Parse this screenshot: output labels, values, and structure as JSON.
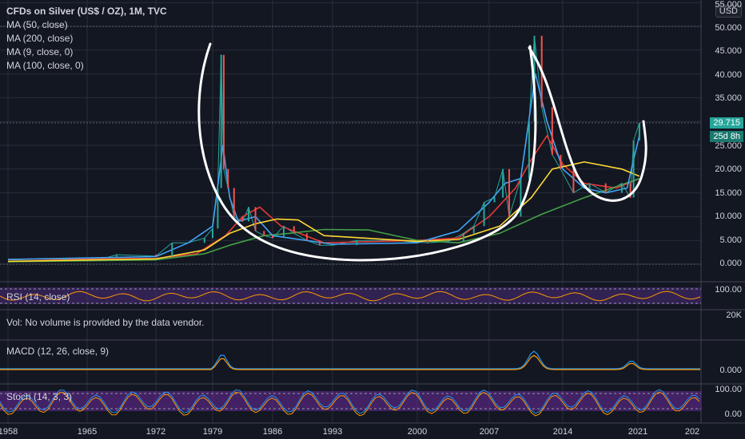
{
  "title": "CFDs on Silver (US$ / OZ), 1M, TVC",
  "indicators": [
    "MA (50, close)",
    "MA (200, close)",
    "MA (9, close, 0)",
    "MA (100, close, 0)"
  ],
  "currency": "USD",
  "last_price": "29.715",
  "countdown": "25d 8h",
  "rsi_label": "RSI (14, close)",
  "vol_label": "Vol: No volume is provided by the data vendor.",
  "macd_label": "MACD (12, 26, close, 9)",
  "stoch_label": "Stoch (14, 3, 3)",
  "colors": {
    "bg": "#131722",
    "grid": "#2a2e39",
    "candle_up": "#26a69a",
    "candle_down": "#ef5350",
    "ma50": "#e53935",
    "ma200": "#43a047",
    "ma9": "#42a5f5",
    "ma100": "#fdd835",
    "rsi_band": "#4a2c7a",
    "stoch_band": "#6a2c9a",
    "price_tag": "#26a69a",
    "annotation": "#ffffff"
  },
  "price_axis": [
    "55.000",
    "50.000",
    "45.000",
    "40.000",
    "35.000",
    "30.000",
    "25.000",
    "20.000",
    "15.000",
    "10.000",
    "5.000",
    "0.000"
  ],
  "rsi_axis": [
    "100.00"
  ],
  "vol_axis": [
    "20K"
  ],
  "macd_axis": [
    "0.000"
  ],
  "stoch_axis": [
    "100.00",
    "0.00"
  ],
  "time_axis": [
    "1958",
    "1965",
    "1972",
    "1979",
    "1986",
    "1993",
    "2000",
    "2007",
    "2014",
    "2021",
    "202"
  ],
  "chart_data": {
    "type": "line",
    "title": "CFDs on Silver (US$ / OZ), 1M, TVC",
    "xlabel": "",
    "ylabel": "",
    "xlim": [
      1958,
      2028
    ],
    "ylim": [
      0,
      55
    ],
    "y_ticks": [
      0,
      5,
      10,
      15,
      20,
      25,
      30,
      35,
      40,
      45,
      50,
      55
    ],
    "x_ticks": [
      1958,
      1965,
      1972,
      1979,
      1986,
      1993,
      2000,
      2007,
      2014,
      2021
    ],
    "series": [
      {
        "name": "",
        "role": "price",
        "x": [
          1958,
          1963,
          1967,
          1968,
          1972,
          1974,
          1976,
          1978,
          1979,
          1979.6,
          1980.0,
          1980.3,
          1980.8,
          1981.5,
          1982.5,
          1983.2,
          1984,
          1985,
          1986,
          1987.3,
          1988.5,
          1990,
          1991.5,
          1993,
          1995,
          1998,
          2001,
          2003,
          2004.5,
          2005.5,
          2006.5,
          2007.5,
          2008.3,
          2008.9,
          2010,
          2010.8,
          2011.3,
          2012,
          2013,
          2013.8,
          2015,
          2016.5,
          2018,
          2019.5,
          2020.3,
          2020.6,
          2021.2
        ],
        "y": [
          0.9,
          1.2,
          1.4,
          2.0,
          1.7,
          4.5,
          4.5,
          5.5,
          7.5,
          16,
          44,
          20,
          16,
          10,
          9,
          12,
          7,
          6,
          5.5,
          8,
          6.5,
          5,
          4,
          4,
          5,
          5,
          4.5,
          4.8,
          6.5,
          8,
          13,
          14,
          20,
          10,
          18,
          30,
          48,
          33,
          23,
          20,
          15,
          17,
          15,
          17,
          14,
          26,
          29.7
        ]
      },
      {
        "name": "MA (50, close)",
        "x": [
          1958,
          1972,
          1977,
          1980.5,
          1982.5,
          1984.5,
          1987,
          1992,
          2000,
          2004,
          2007,
          2009.5,
          2011,
          2012.5,
          2014,
          2016,
          2019,
          2021.2
        ],
        "y": [
          1,
          1.2,
          2.2,
          6,
          10,
          12,
          8,
          4.5,
          5,
          5.5,
          10,
          16,
          22,
          27,
          21,
          17,
          16,
          18
        ]
      },
      {
        "name": "MA (200, close)",
        "x": [
          1958,
          1972,
          1978,
          1981,
          1985,
          1988,
          1992,
          1996,
          2000,
          2004,
          2008,
          2012,
          2016,
          2021.2
        ],
        "y": [
          0.5,
          0.9,
          2.2,
          4,
          6,
          6.5,
          7.3,
          7.2,
          5,
          4.5,
          6.5,
          10.5,
          14,
          18
        ]
      },
      {
        "name": "MA (9, close, 0)",
        "x": [
          1958,
          1972,
          1976,
          1979,
          1980.2,
          1981,
          1982,
          1984,
          1986,
          1993,
          2000,
          2004,
          2007,
          2008.5,
          2010,
          2011.4,
          2012.5,
          2014,
          2016,
          2018,
          2020,
          2020.6,
          2021.2
        ],
        "y": [
          1,
          1.6,
          4.5,
          8,
          25,
          14,
          9,
          10,
          6,
          4.2,
          4.5,
          7,
          13,
          17,
          18,
          40,
          30,
          20,
          16,
          15,
          16,
          22,
          27
        ]
      },
      {
        "name": "MA (100, close, 0)",
        "x": [
          1958,
          1972,
          1978,
          1981,
          1984,
          1986.5,
          1989,
          1992,
          2000,
          2004,
          2008,
          2011,
          2013,
          2016,
          2019.5,
          2021.2
        ],
        "y": [
          0.6,
          1.1,
          3,
          6.5,
          8.5,
          9.5,
          9.3,
          6,
          4.8,
          5.2,
          8,
          14,
          20,
          21.5,
          20,
          18.5
        ]
      }
    ]
  }
}
